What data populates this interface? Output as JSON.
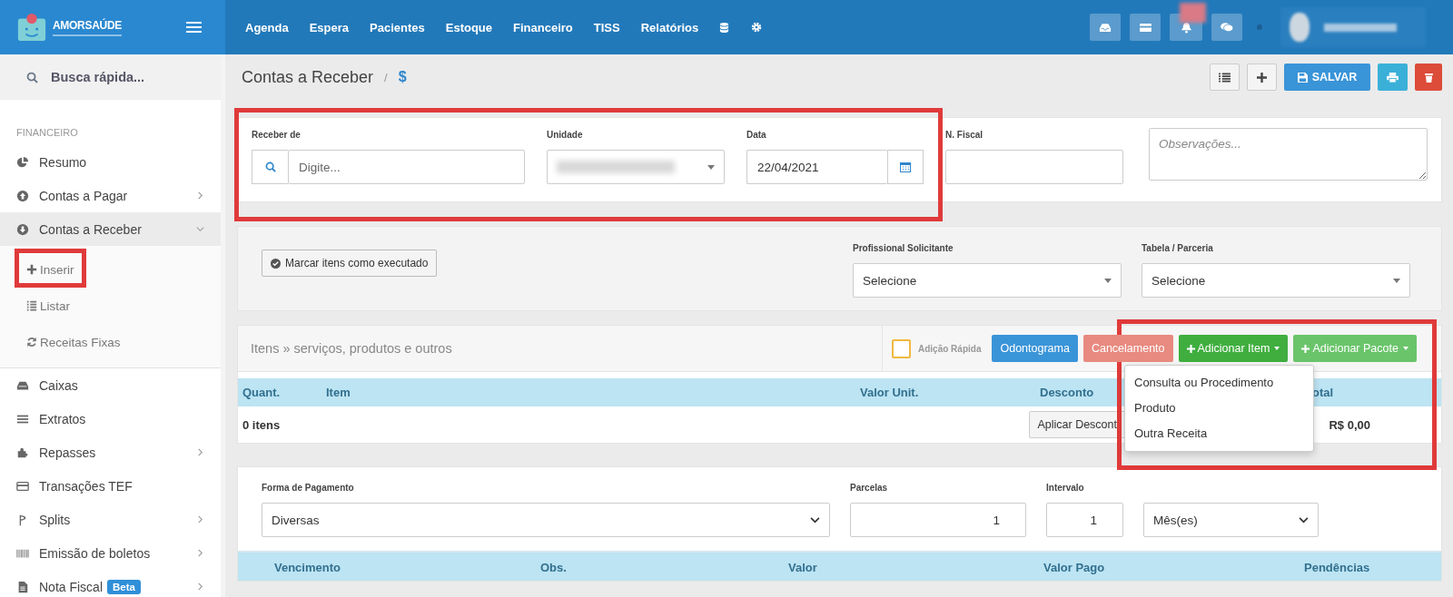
{
  "brand": {
    "name": "AMORSAÚDE"
  },
  "nav": {
    "items": [
      "Agenda",
      "Espera",
      "Pacientes",
      "Estoque",
      "Financeiro",
      "TISS",
      "Relatórios"
    ]
  },
  "sidebar": {
    "search_placeholder": "Busca rápida...",
    "section": "FINANCEIRO",
    "items": [
      {
        "label": "Resumo",
        "kind": "link",
        "selected": false
      },
      {
        "label": "Contas a Pagar",
        "kind": "group",
        "expanded": false,
        "selected": false
      },
      {
        "label": "Contas a Receber",
        "kind": "group",
        "expanded": true,
        "selected": true,
        "children": [
          {
            "label": "Inserir"
          },
          {
            "label": "Listar"
          },
          {
            "label": "Receitas Fixas"
          }
        ]
      },
      {
        "label": "Caixas",
        "kind": "link",
        "selected": false
      },
      {
        "label": "Extratos",
        "kind": "link",
        "selected": false
      },
      {
        "label": "Repasses",
        "kind": "group",
        "expanded": false,
        "selected": false
      },
      {
        "label": "Transações TEF",
        "kind": "link",
        "selected": false
      },
      {
        "label": "Splits",
        "kind": "group",
        "expanded": false,
        "selected": false
      },
      {
        "label": "Emissão de boletos",
        "kind": "group",
        "expanded": false,
        "selected": false
      },
      {
        "label": "Nota Fiscal",
        "kind": "group",
        "expanded": false,
        "selected": false,
        "badge": "Beta"
      }
    ]
  },
  "page": {
    "title": "Contas a Receber",
    "breadcrumb_divider": "/",
    "breadcrumb_symbol": "$",
    "save_button": "SALVAR"
  },
  "header_form": {
    "receber_de": {
      "label": "Receber de",
      "placeholder": "Digite..."
    },
    "unidade": {
      "label": "Unidade"
    },
    "data": {
      "label": "Data",
      "value": "22/04/2021"
    },
    "n_fiscal": {
      "label": "N. Fiscal"
    },
    "observacoes": {
      "placeholder": "Observações..."
    }
  },
  "execution": {
    "mark_button": "Marcar itens como executado",
    "profissional": {
      "label": "Profissional Solicitante",
      "value": "Selecione"
    },
    "tabela": {
      "label": "Tabela / Parceria",
      "value": "Selecione"
    }
  },
  "items": {
    "title": "Itens » serviços, produtos e outros",
    "quick_add": {
      "label": "Adição Rápida",
      "checked": false
    },
    "buttons": {
      "odontograma": "Odontograma",
      "cancelamento": "Cancelamento",
      "adicionar_item": "Adicionar Item",
      "adicionar_pacote": "Adicionar Pacote"
    },
    "columns": [
      "Quant.",
      "Item",
      "Valor Unit.",
      "Desconto",
      "otal"
    ],
    "count": "0 itens",
    "discount_button": "Aplicar Descont",
    "total": "R$ 0,00",
    "menu": [
      "Consulta ou Procedimento",
      "Produto",
      "Outra Receita"
    ]
  },
  "payment": {
    "forma": {
      "label": "Forma de Pagamento",
      "value": "Diversas"
    },
    "parcelas": {
      "label": "Parcelas",
      "value": "1"
    },
    "intervalo": {
      "label": "Intervalo",
      "value": "1"
    },
    "periodo": {
      "value": "Mês(es)"
    },
    "columns": [
      "Vencimento",
      "Obs.",
      "Valor",
      "Valor Pago",
      "Pendências"
    ]
  }
}
